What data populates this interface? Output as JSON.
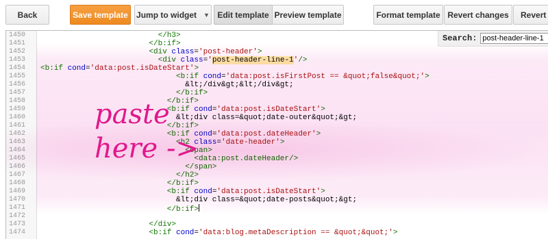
{
  "toolbar": {
    "back_label": "Back",
    "save_label": "Save template",
    "jump_label": "Jump to widget",
    "edit_label": "Edit template",
    "preview_label": "Preview template",
    "format_label": "Format template",
    "revert_changes_label": "Revert changes",
    "revert_widget_label": "Revert w"
  },
  "search": {
    "label": "Search:",
    "value": "post-header-line-1"
  },
  "annotation": {
    "text": "paste\nhere ->",
    "color": "#e0188c"
  },
  "colors": {
    "save_button": "#f39a32",
    "tag": "#117700",
    "attribute": "#0000cc",
    "string": "#aa1111",
    "search_highlight": "#fff0a8",
    "annotation": "#e0188c"
  },
  "editor": {
    "lines": [
      {
        "num": "1450",
        "indent": 26,
        "tokens": [
          {
            "t": "tag",
            "v": "</h3>"
          }
        ]
      },
      {
        "num": "1451",
        "indent": 24,
        "tokens": [
          {
            "t": "tag",
            "v": "</b:if>"
          }
        ]
      },
      {
        "num": "1452",
        "indent": 24,
        "tokens": [
          {
            "t": "tag",
            "v": "<div "
          },
          {
            "t": "attr",
            "v": "class"
          },
          {
            "t": "ent",
            "v": "="
          },
          {
            "t": "str",
            "v": "'post-header'"
          },
          {
            "t": "tag",
            "v": ">"
          }
        ]
      },
      {
        "num": "1453",
        "indent": 26,
        "tokens": [
          {
            "t": "tag",
            "v": "<div "
          },
          {
            "t": "attr",
            "v": "class"
          },
          {
            "t": "ent",
            "v": "="
          },
          {
            "t": "str",
            "v": "'"
          },
          {
            "t": "hl",
            "v": "post-header-line-1"
          },
          {
            "t": "str",
            "v": "'"
          },
          {
            "t": "tag",
            "v": "/>"
          }
        ]
      },
      {
        "num": "1454",
        "indent": 0,
        "tokens": [
          {
            "t": "tag",
            "v": "<b:if "
          },
          {
            "t": "attr",
            "v": "cond"
          },
          {
            "t": "ent",
            "v": "="
          },
          {
            "t": "str",
            "v": "'data:post.isDateStart'"
          },
          {
            "t": "tag",
            "v": ">"
          }
        ]
      },
      {
        "num": "1455",
        "indent": 30,
        "tokens": [
          {
            "t": "tag",
            "v": "<b:if "
          },
          {
            "t": "attr",
            "v": "cond"
          },
          {
            "t": "ent",
            "v": "="
          },
          {
            "t": "str",
            "v": "'data:post.isFirstPost == &quot;false&quot;'"
          },
          {
            "t": "tag",
            "v": ">"
          }
        ]
      },
      {
        "num": "1456",
        "indent": 32,
        "tokens": [
          {
            "t": "ent",
            "v": "&lt;/div&gt;&lt;/div&gt;"
          }
        ]
      },
      {
        "num": "1457",
        "indent": 30,
        "tokens": [
          {
            "t": "tag",
            "v": "</b:if>"
          }
        ]
      },
      {
        "num": "1458",
        "indent": 28,
        "tokens": [
          {
            "t": "tag",
            "v": "</b:if>"
          }
        ]
      },
      {
        "num": "1459",
        "indent": 28,
        "tokens": [
          {
            "t": "tag",
            "v": "<b:if "
          },
          {
            "t": "attr",
            "v": "cond"
          },
          {
            "t": "ent",
            "v": "="
          },
          {
            "t": "str",
            "v": "'data:post.isDateStart'"
          },
          {
            "t": "tag",
            "v": ">"
          }
        ]
      },
      {
        "num": "1460",
        "indent": 30,
        "tokens": [
          {
            "t": "ent",
            "v": "&lt;div class=&quot;date-outer&quot;&gt;"
          }
        ]
      },
      {
        "num": "1461",
        "indent": 28,
        "tokens": [
          {
            "t": "tag",
            "v": "</b:if>"
          }
        ]
      },
      {
        "num": "1462",
        "indent": 28,
        "tokens": [
          {
            "t": "tag",
            "v": "<b:if "
          },
          {
            "t": "attr",
            "v": "cond"
          },
          {
            "t": "ent",
            "v": "="
          },
          {
            "t": "str",
            "v": "'data:post.dateHeader'"
          },
          {
            "t": "tag",
            "v": ">"
          }
        ]
      },
      {
        "num": "1463",
        "indent": 30,
        "tokens": [
          {
            "t": "tag",
            "v": "<h2 "
          },
          {
            "t": "attr",
            "v": "class"
          },
          {
            "t": "ent",
            "v": "="
          },
          {
            "t": "str",
            "v": "'date-header'"
          },
          {
            "t": "tag",
            "v": ">"
          }
        ]
      },
      {
        "num": "1464",
        "indent": 32,
        "tokens": [
          {
            "t": "tag",
            "v": "<span>"
          }
        ]
      },
      {
        "num": "1465",
        "indent": 34,
        "tokens": [
          {
            "t": "tag",
            "v": "<data:post.dateHeader/>"
          }
        ]
      },
      {
        "num": "1466",
        "indent": 32,
        "tokens": [
          {
            "t": "tag",
            "v": "</span>"
          }
        ]
      },
      {
        "num": "1467",
        "indent": 30,
        "tokens": [
          {
            "t": "tag",
            "v": "</h2>"
          }
        ]
      },
      {
        "num": "1468",
        "indent": 28,
        "tokens": [
          {
            "t": "tag",
            "v": "</b:if>"
          }
        ]
      },
      {
        "num": "1469",
        "indent": 28,
        "tokens": [
          {
            "t": "tag",
            "v": "<b:if "
          },
          {
            "t": "attr",
            "v": "cond"
          },
          {
            "t": "ent",
            "v": "="
          },
          {
            "t": "str",
            "v": "'data:post.isDateStart'"
          },
          {
            "t": "tag",
            "v": ">"
          }
        ]
      },
      {
        "num": "1470",
        "indent": 30,
        "tokens": [
          {
            "t": "ent",
            "v": "&lt;div class=&quot;date-posts&quot;&gt;"
          }
        ]
      },
      {
        "num": "1471",
        "indent": 28,
        "tokens": [
          {
            "t": "tag",
            "v": "</b:if>"
          },
          {
            "t": "cursor",
            "v": ""
          }
        ]
      },
      {
        "num": "1472",
        "indent": 0,
        "tokens": []
      },
      {
        "num": "1473",
        "indent": 24,
        "tokens": [
          {
            "t": "tag",
            "v": "</div>"
          }
        ]
      },
      {
        "num": "1474",
        "indent": 24,
        "tokens": [
          {
            "t": "tag",
            "v": "<b:if "
          },
          {
            "t": "attr",
            "v": "cond"
          },
          {
            "t": "ent",
            "v": "="
          },
          {
            "t": "str",
            "v": "'data:blog.metaDescription == &quot;&quot;'"
          },
          {
            "t": "tag",
            "v": ">"
          }
        ]
      }
    ]
  }
}
